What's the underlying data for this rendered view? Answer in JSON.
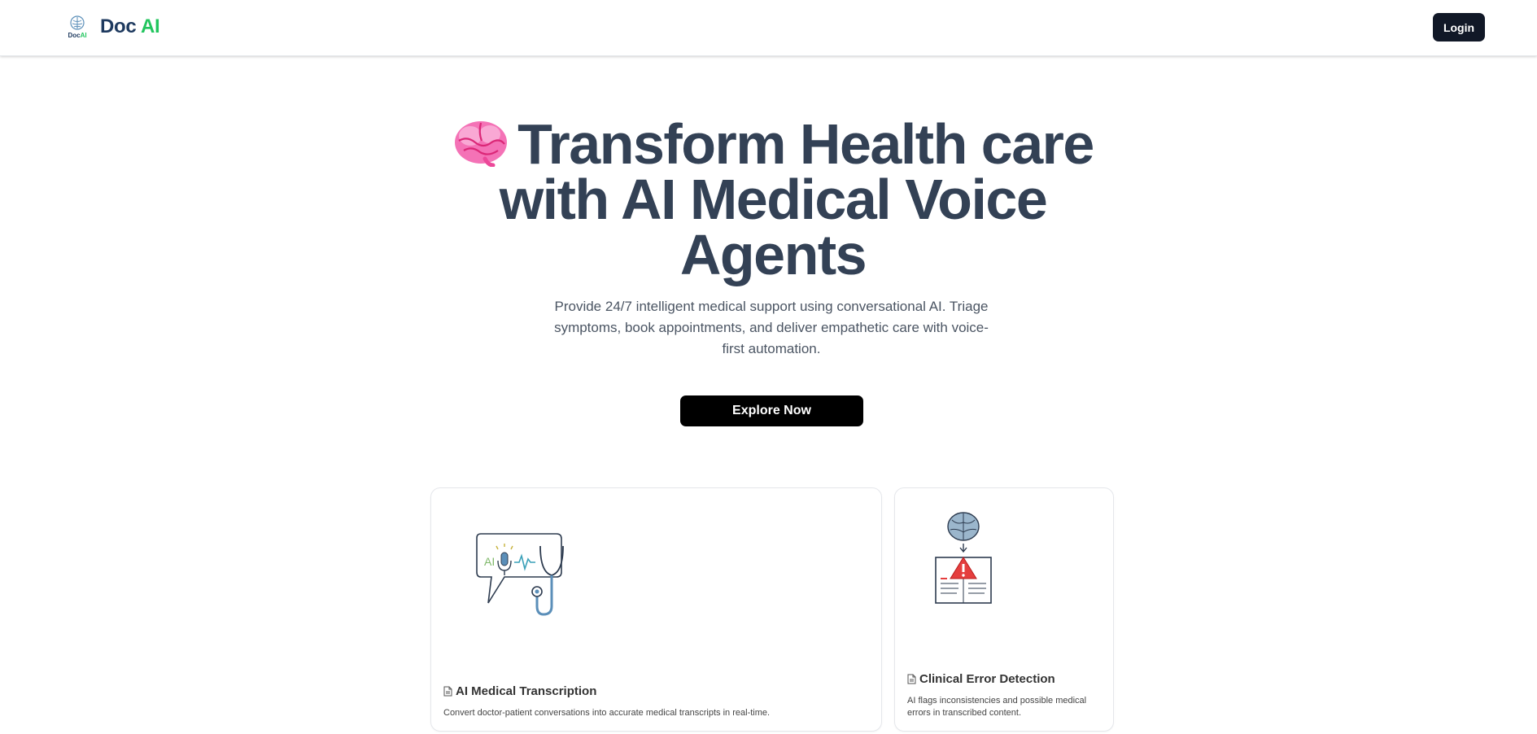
{
  "header": {
    "logo_mark": {
      "doc": "Doc",
      "ai": "AI"
    },
    "brand": {
      "doc": "Doc",
      "ai": "AI"
    },
    "login_label": "Login"
  },
  "hero": {
    "emoji_icon": "brain-emoji",
    "title": "Transform Health care with AI Medical Voice Agents",
    "subtitle": "Provide 24/7 intelligent medical support using conversational AI. Triage symptoms, book appointments, and deliver empathetic care with voice-first automation.",
    "cta_label": "Explore Now"
  },
  "features": [
    {
      "title": "AI Medical Transcription",
      "description": "Convert doctor-patient conversations into accurate medical transcripts in real-time.",
      "illustration": "speech-bubble-stethoscope-illustration",
      "illustration_text": "AI"
    },
    {
      "title": "Clinical Error Detection",
      "description": "AI flags inconsistencies and possible medical errors in transcribed content.",
      "illustration": "brain-document-warning-illustration"
    }
  ],
  "colors": {
    "brand_dark": "#1e3a5f",
    "brand_accent": "#22c55e",
    "heading": "#334155",
    "button_bg": "#000000",
    "login_bg": "#111827"
  }
}
